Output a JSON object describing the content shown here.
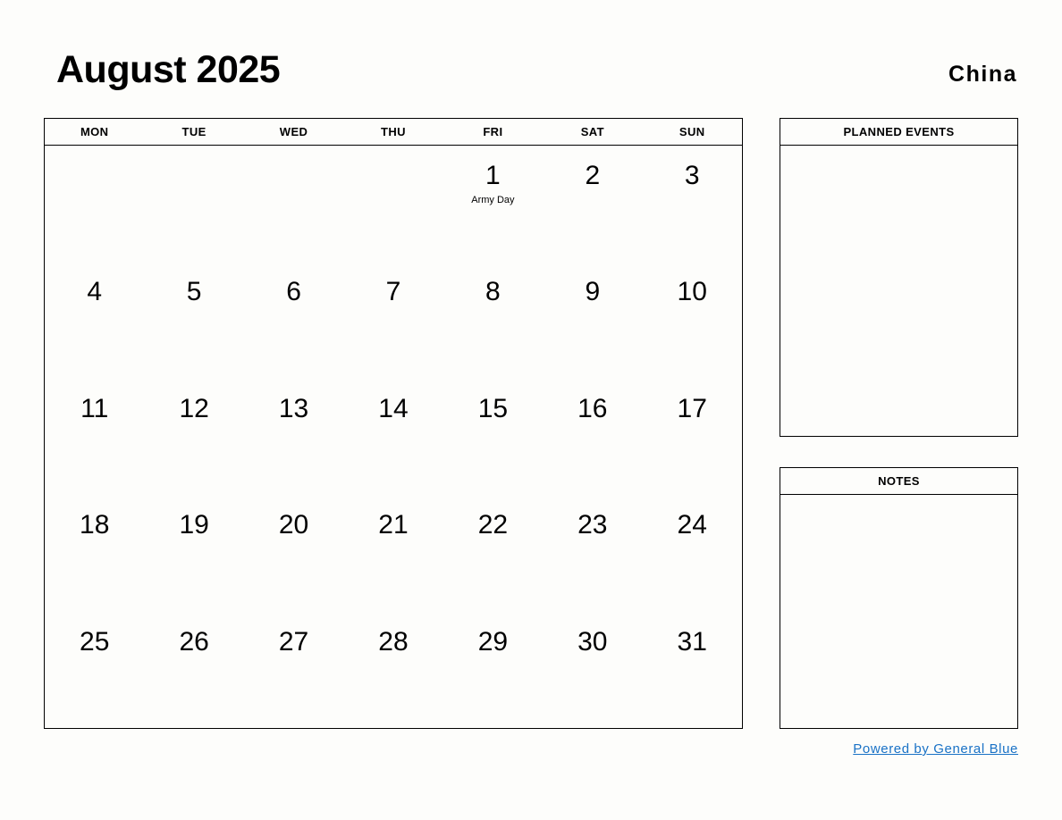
{
  "header": {
    "month_title": "August 2025",
    "country": "China"
  },
  "calendar": {
    "weekdays": [
      "MON",
      "TUE",
      "WED",
      "THU",
      "FRI",
      "SAT",
      "SUN"
    ],
    "weeks": [
      [
        {
          "day": "",
          "event": ""
        },
        {
          "day": "",
          "event": ""
        },
        {
          "day": "",
          "event": ""
        },
        {
          "day": "",
          "event": ""
        },
        {
          "day": "1",
          "event": "Army Day"
        },
        {
          "day": "2",
          "event": ""
        },
        {
          "day": "3",
          "event": ""
        }
      ],
      [
        {
          "day": "4",
          "event": ""
        },
        {
          "day": "5",
          "event": ""
        },
        {
          "day": "6",
          "event": ""
        },
        {
          "day": "7",
          "event": ""
        },
        {
          "day": "8",
          "event": ""
        },
        {
          "day": "9",
          "event": ""
        },
        {
          "day": "10",
          "event": ""
        }
      ],
      [
        {
          "day": "11",
          "event": ""
        },
        {
          "day": "12",
          "event": ""
        },
        {
          "day": "13",
          "event": ""
        },
        {
          "day": "14",
          "event": ""
        },
        {
          "day": "15",
          "event": ""
        },
        {
          "day": "16",
          "event": ""
        },
        {
          "day": "17",
          "event": ""
        }
      ],
      [
        {
          "day": "18",
          "event": ""
        },
        {
          "day": "19",
          "event": ""
        },
        {
          "day": "20",
          "event": ""
        },
        {
          "day": "21",
          "event": ""
        },
        {
          "day": "22",
          "event": ""
        },
        {
          "day": "23",
          "event": ""
        },
        {
          "day": "24",
          "event": ""
        }
      ],
      [
        {
          "day": "25",
          "event": ""
        },
        {
          "day": "26",
          "event": ""
        },
        {
          "day": "27",
          "event": ""
        },
        {
          "day": "28",
          "event": ""
        },
        {
          "day": "29",
          "event": ""
        },
        {
          "day": "30",
          "event": ""
        },
        {
          "day": "31",
          "event": ""
        }
      ]
    ]
  },
  "panels": {
    "planned_events": {
      "title": "PLANNED EVENTS",
      "content": ""
    },
    "notes": {
      "title": "NOTES",
      "content": ""
    }
  },
  "footer": {
    "link_text": "Powered by General Blue",
    "link_color": "#1a72c6"
  }
}
